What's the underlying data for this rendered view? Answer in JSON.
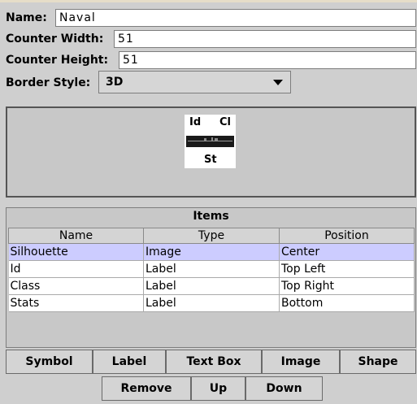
{
  "form": {
    "name_label": "Name:",
    "name_value": "Naval",
    "width_label": "Counter Width:",
    "width_value": "51",
    "height_label": "Counter Height:",
    "height_value": "51",
    "border_label": "Border Style:",
    "border_value": "3D"
  },
  "preview": {
    "top_left": "Id",
    "top_right": "Cl",
    "bottom": "St"
  },
  "items": {
    "title": "Items",
    "columns": [
      "Name",
      "Type",
      "Position"
    ],
    "rows": [
      [
        "Silhouette",
        "Image",
        "Center"
      ],
      [
        "Id",
        "Label",
        "Top Left"
      ],
      [
        "Class",
        "Label",
        "Top Right"
      ],
      [
        "Stats",
        "Label",
        "Bottom"
      ]
    ],
    "selected_row": 0
  },
  "buttons": {
    "symbol": "Symbol",
    "label": "Label",
    "text_box": "Text Box",
    "image": "Image",
    "shape": "Shape",
    "remove": "Remove",
    "up": "Up",
    "down": "Down"
  }
}
